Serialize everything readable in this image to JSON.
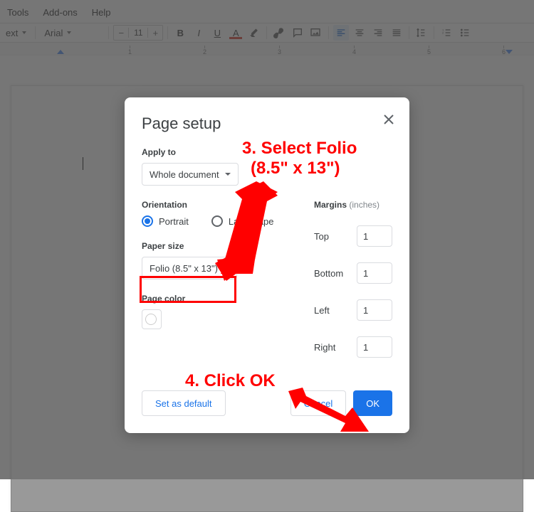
{
  "menu": {
    "items": [
      "Tools",
      "Add-ons",
      "Help"
    ]
  },
  "toolbar": {
    "style_label": "ext",
    "font_label": "Arial",
    "font_size": "11"
  },
  "ruler": {
    "ticks": [
      "1",
      "2",
      "3",
      "4",
      "5",
      "6"
    ]
  },
  "modal": {
    "title": "Page setup",
    "applyto_label": "Apply to",
    "applyto_value": "Whole document",
    "orientation_label": "Orientation",
    "orientation_portrait": "Portrait",
    "orientation_landscape": "Landscape",
    "paper_size_label": "Paper size",
    "paper_size_value": "Folio (8.5\" x 13\")",
    "page_color_label": "Page color",
    "margins_label": "Margins",
    "margins_unit": "(inches)",
    "margins": {
      "top": {
        "label": "Top",
        "value": "1"
      },
      "bottom": {
        "label": "Bottom",
        "value": "1"
      },
      "left": {
        "label": "Left",
        "value": "1"
      },
      "right": {
        "label": "Right",
        "value": "1"
      }
    },
    "set_default": "Set as default",
    "cancel": "Cancel",
    "ok": "OK"
  },
  "annotations": {
    "a3_line1": "3. Select Folio",
    "a3_line2": "(8.5\" x 13\")",
    "a4": "4. Click OK"
  }
}
